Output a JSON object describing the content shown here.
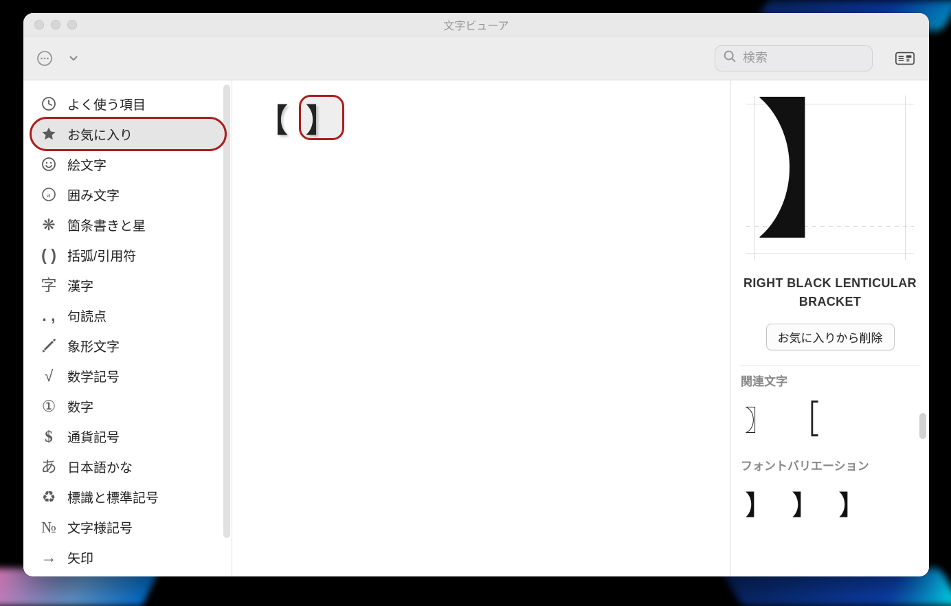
{
  "window": {
    "title": "文字ビューア"
  },
  "toolbar": {
    "search_placeholder": "検索"
  },
  "sidebar": {
    "items": [
      {
        "key": "recent",
        "label": "よく使う項目"
      },
      {
        "key": "favorites",
        "label": "お気に入り",
        "active": true
      },
      {
        "key": "emoji",
        "label": "絵文字"
      },
      {
        "key": "enclosed",
        "label": "囲み文字"
      },
      {
        "key": "bullets",
        "label": "箇条書きと星"
      },
      {
        "key": "brackets",
        "label": "括弧/引用符"
      },
      {
        "key": "kanji",
        "label": "漢字"
      },
      {
        "key": "punct",
        "label": "句読点"
      },
      {
        "key": "picto",
        "label": "象形文字"
      },
      {
        "key": "math",
        "label": "数学記号"
      },
      {
        "key": "digits",
        "label": "数字"
      },
      {
        "key": "currency",
        "label": "通貨記号"
      },
      {
        "key": "kana",
        "label": "日本語かな"
      },
      {
        "key": "signs",
        "label": "標識と標準記号"
      },
      {
        "key": "letterlike",
        "label": "文字様記号"
      },
      {
        "key": "arrows",
        "label": "矢印"
      }
    ]
  },
  "grid": {
    "characters": [
      {
        "glyph": "【",
        "selected": false
      },
      {
        "glyph": "】",
        "selected": true
      }
    ]
  },
  "inspector": {
    "preview_glyph": "】",
    "char_name": "RIGHT BLACK LENTICULAR BRACKET",
    "remove_label": "お気に入りから削除",
    "related_title": "関連文字",
    "related": [
      "〗",
      "﹈"
    ],
    "fontvar_title": "フォントバリエーション",
    "font_variations": [
      "】",
      "】",
      "】"
    ]
  }
}
